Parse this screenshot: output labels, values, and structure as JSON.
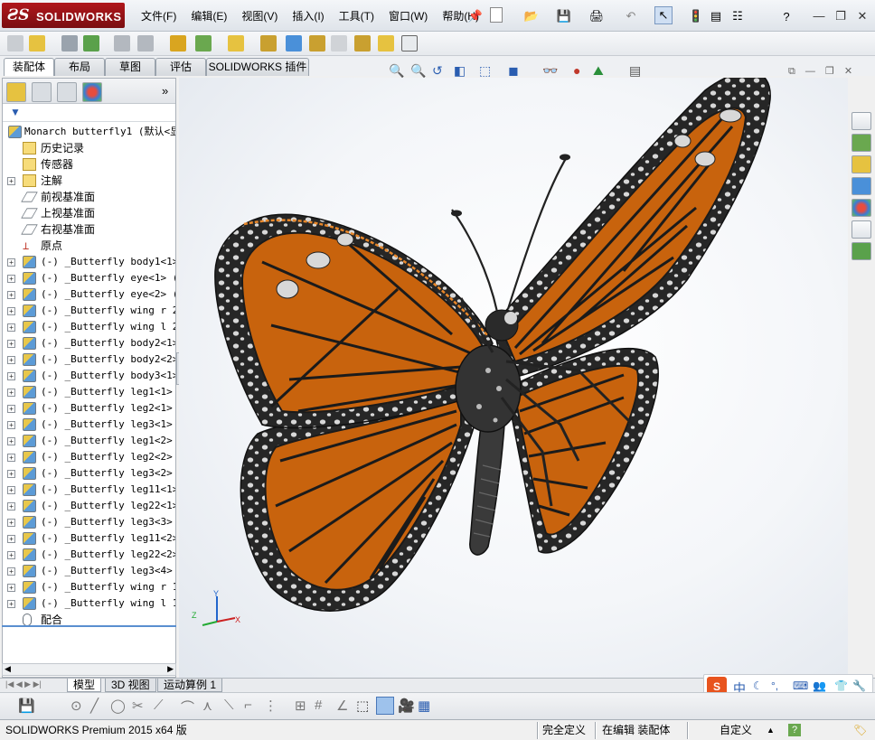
{
  "window": {
    "logo_ds": "ƧS",
    "logo_text": "SOLIDWORKS",
    "menu": [
      "文件(F)",
      "编辑(E)",
      "视图(V)",
      "插入(I)",
      "工具(T)",
      "窗口(W)",
      "帮助(H)"
    ]
  },
  "command_tabs": [
    "装配体",
    "布局",
    "草图",
    "评估",
    "SOLIDWORKS 插件"
  ],
  "feature_tree": {
    "root": "Monarch butterfly1  (默认<显",
    "fixed_items": [
      "历史记录",
      "传感器",
      "注解",
      "前视基准面",
      "上视基准面",
      "右视基准面",
      "原点"
    ],
    "components": [
      "(-) _Butterfly body1<1> (",
      "(-) _Butterfly eye<1> (默",
      "(-) _Butterfly eye<2> (默",
      "(-) _Butterfly wing r 2<1",
      "(-) _Butterfly wing l 2<1",
      "(-) _Butterfly body2<1> (",
      "(-) _Butterfly body2<2> (",
      "(-) _Butterfly body3<1> (",
      "(-) _Butterfly leg1<1> (",
      "(-) _Butterfly leg2<1> (",
      "(-) _Butterfly leg3<1> (",
      "(-) _Butterfly leg1<2> (",
      "(-) _Butterfly leg2<2> (",
      "(-) _Butterfly leg3<2> (",
      "(-) _Butterfly leg11<1> (",
      "(-) _Butterfly leg22<1> (",
      "(-) _Butterfly leg3<3> (",
      "(-) _Butterfly leg11<2> (",
      "(-) _Butterfly leg22<2> (",
      "(-) _Butterfly leg3<4> (",
      "(-) _Butterfly wing r 1<1",
      "(-) _Butterfly wing l 1<1"
    ],
    "mates": "配合"
  },
  "bottom_tabs": [
    "模型",
    "3D 视图",
    "运动算例 1"
  ],
  "triad": {
    "x": "X",
    "y": "Y",
    "z": "Z"
  },
  "ime": {
    "brand": "S",
    "mode": "中"
  },
  "status": {
    "product": "SOLIDWORKS Premium 2015 x64 版",
    "definition": "完全定义",
    "editing": "在编辑 装配体",
    "custom": "自定义"
  },
  "colors": {
    "wing_orange": "#c8630d",
    "wing_black": "#2a2a2a",
    "accent_red": "#b0171c"
  }
}
